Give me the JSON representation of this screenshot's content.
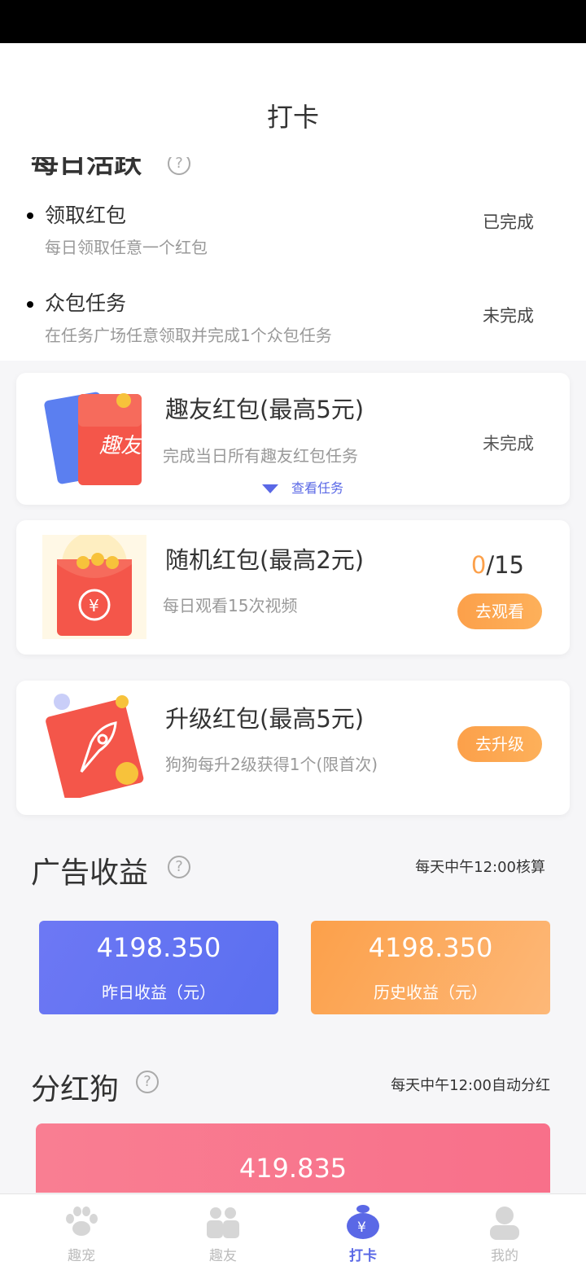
{
  "header": {
    "title": "打卡"
  },
  "daily": {
    "title": "每日活跃",
    "help": "?",
    "tasks": [
      {
        "name": "领取红包",
        "desc": "每日领取任意一个红包",
        "status": "已完成"
      },
      {
        "name": "众包任务",
        "desc": "在任务广场任意领取并完成1个众包任务",
        "status": "未完成"
      }
    ]
  },
  "cards": {
    "friend": {
      "title": "趣友红包(最高5元)",
      "desc": "完成当日所有趣友红包任务",
      "status": "未完成",
      "view_tasks": "查看任务",
      "badge": "趣友"
    },
    "random": {
      "title": "随机红包(最高2元)",
      "desc": "每日观看15次视频",
      "progress_current": "0",
      "progress_total": "/15",
      "button": "去观看",
      "badge": "¥"
    },
    "upgrade": {
      "title": "升级红包(最高5元)",
      "desc": "狗狗每升2级获得1个(限首次)",
      "button": "去升级"
    }
  },
  "ads": {
    "title": "广告收益",
    "help": "?",
    "note": "每天中午12:00核算",
    "yesterday_value": "4198.350",
    "yesterday_label": "昨日收益（元）",
    "history_value": "4198.350",
    "history_label": "历史收益（元）"
  },
  "dividend": {
    "title": "分红狗",
    "help": "?",
    "note": "每天中午12:00自动分红",
    "value": "419.835"
  },
  "tabs": [
    {
      "label": "趣宠",
      "icon": "paw-icon"
    },
    {
      "label": "趣友",
      "icon": "friends-icon"
    },
    {
      "label": "打卡",
      "icon": "money-bag-icon",
      "active": true
    },
    {
      "label": "我的",
      "icon": "user-icon"
    }
  ],
  "colors": {
    "accent": "#5a68e6",
    "orange": "#fca04a",
    "pink": "#f8708a"
  }
}
